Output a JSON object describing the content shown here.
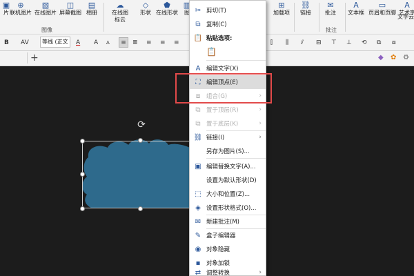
{
  "ribbon": {
    "items": [
      {
        "label": "片",
        "icon": "image-icon"
      },
      {
        "label": "联机图片",
        "icon": "online-picture-icon"
      },
      {
        "label": "在线图片",
        "icon": "picture-icon"
      },
      {
        "label": "屏幕截图",
        "icon": "screenshot-icon"
      },
      {
        "label": "相册",
        "icon": "album-icon"
      },
      {
        "label": "在线图标云",
        "icon": "icon-cloud-icon"
      },
      {
        "label": "形状",
        "icon": "shapes-icon"
      },
      {
        "label": "在线形状",
        "icon": "online-shape-icon"
      },
      {
        "label": "图",
        "icon": "image-icon"
      },
      {
        "label": "加载项",
        "icon": "addin-icon"
      },
      {
        "label": "链接",
        "icon": "link-icon"
      },
      {
        "label": "批注",
        "icon": "comment-icon"
      },
      {
        "label": "文本框",
        "icon": "textbox-icon"
      },
      {
        "label": "页眉和页脚",
        "icon": "header-footer-icon"
      },
      {
        "label": "艺术字",
        "icon": "wordart-icon"
      },
      {
        "label": "文字云",
        "icon": "wordcloud-icon"
      }
    ],
    "group_images": "图像",
    "group_comments": "批注"
  },
  "format": {
    "font": "等线 (正文",
    "bold": "B",
    "av": "AV",
    "font_color": "A",
    "grow": "A",
    "shrink": "A"
  },
  "tabs": {
    "add": "+"
  },
  "menu": {
    "cut": "剪切(T)",
    "copy": "复制(C)",
    "paste_options": "粘贴选项:",
    "edit_text": "编辑文字(X)",
    "edit_points": "编辑顶点(E)",
    "group": "组合(G)",
    "bring_front": "置于顶层(R)",
    "send_back": "置于底层(K)",
    "link": "链接(I)",
    "save_picture": "另存为图片(S)...",
    "alt_text": "编辑替换文字(A)...",
    "default_shape": "设置为默认形状(D)",
    "size_position": "大小和位置(Z)...",
    "format_shape": "设置形状格式(O)...",
    "new_comment": "新建批注(M)",
    "box_editor": "盒子编辑器",
    "hide_object": "对象隐藏",
    "lock_object": "对象加锁",
    "adjust": "调整转换"
  },
  "colors": {
    "shape": "#2e6a8c",
    "highlight": "#e24a4a"
  }
}
